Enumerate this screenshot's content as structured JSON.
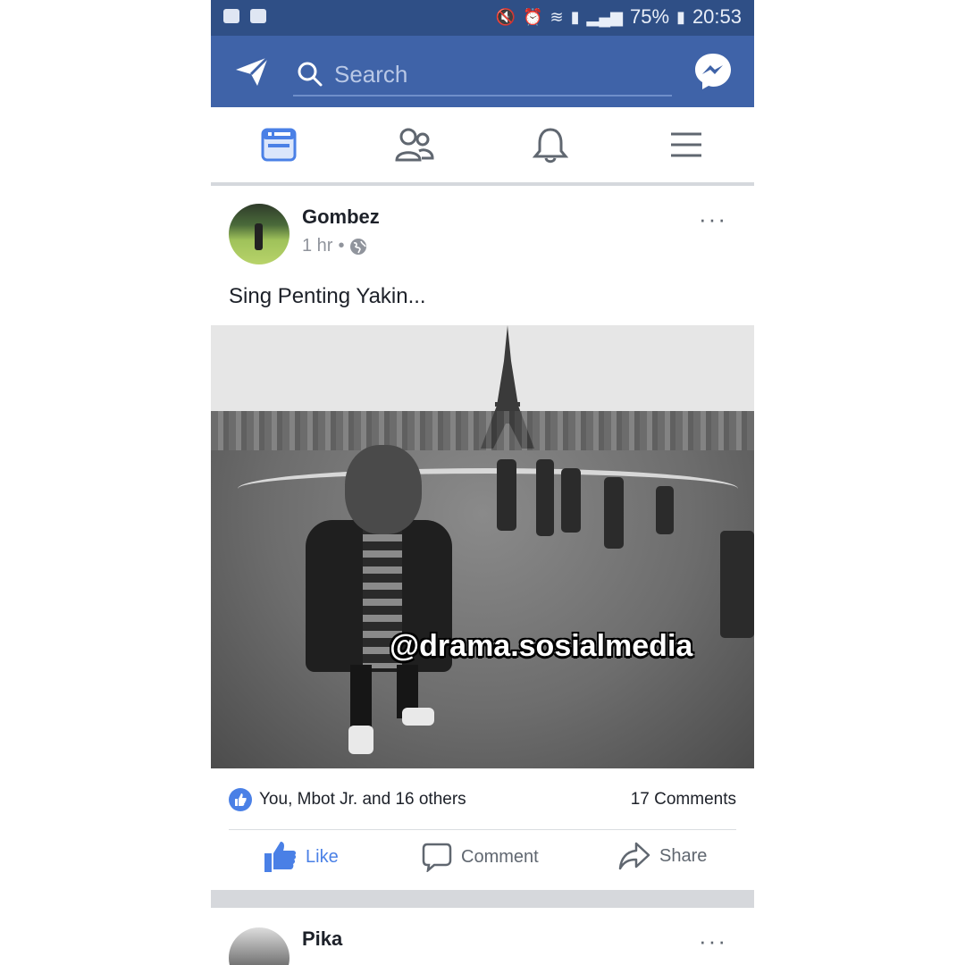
{
  "status_bar": {
    "battery": "75%",
    "time": "20:53",
    "left_icons": [
      "bbm-icon",
      "gallery-icon"
    ],
    "right_icons": [
      "mute-icon",
      "alarm-icon",
      "wifi-icon",
      "sim-icon",
      "signal-icon",
      "battery-icon"
    ]
  },
  "header": {
    "search_placeholder": "Search",
    "left_icon": "paper-plane-icon",
    "right_icon": "messenger-icon",
    "accent_color": "#3f63a8"
  },
  "nav": {
    "items": [
      {
        "name": "news-feed",
        "icon": "news-feed-icon",
        "active": true
      },
      {
        "name": "friends",
        "icon": "friends-icon",
        "active": false
      },
      {
        "name": "notifications",
        "icon": "bell-icon",
        "active": false
      },
      {
        "name": "menu",
        "icon": "hamburger-icon",
        "active": false
      }
    ]
  },
  "post": {
    "author": "Gombez",
    "time": "1 hr",
    "separator": "•",
    "text": "Sing Penting Yakin...",
    "watermark": "@drama.sosialmedia",
    "reactions": "You, Mbot Jr. and 16 others",
    "comments": "17 Comments",
    "actions": {
      "like": "Like",
      "comment": "Comment",
      "share": "Share"
    },
    "more": "···"
  },
  "next_post": {
    "author": "Pika",
    "more": "···"
  }
}
